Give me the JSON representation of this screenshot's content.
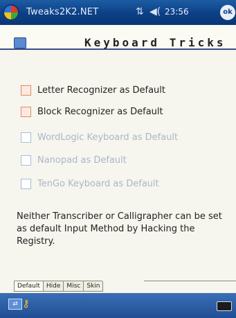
{
  "statusbar": {
    "app_title": "Tweaks2K2.NET",
    "time": "23:56",
    "signal_glyph": "⇅",
    "volume_glyph": "◀("
  },
  "header": {
    "title": "Keyboard Tricks"
  },
  "options": [
    {
      "label": "Letter Recognizer as Default",
      "enabled": true
    },
    {
      "label": "Block Recognizer as Default",
      "enabled": true
    },
    {
      "label": "WordLogic Keyboard as Default",
      "enabled": false
    },
    {
      "label": "Nanopad as Default",
      "enabled": false
    },
    {
      "label": "TenGo Keyboard as Default",
      "enabled": false
    }
  ],
  "note": "Neither Transcriber or Calligrapher can be set as default Input Method by Hacking the Registry.",
  "tabs": [
    {
      "label": "Default",
      "active": true
    },
    {
      "label": "Hide",
      "active": false
    },
    {
      "label": "Misc",
      "active": false
    },
    {
      "label": "Skin",
      "active": false
    }
  ],
  "menubar": {
    "sip_label": "⇄",
    "key_glyph": "⚷"
  }
}
